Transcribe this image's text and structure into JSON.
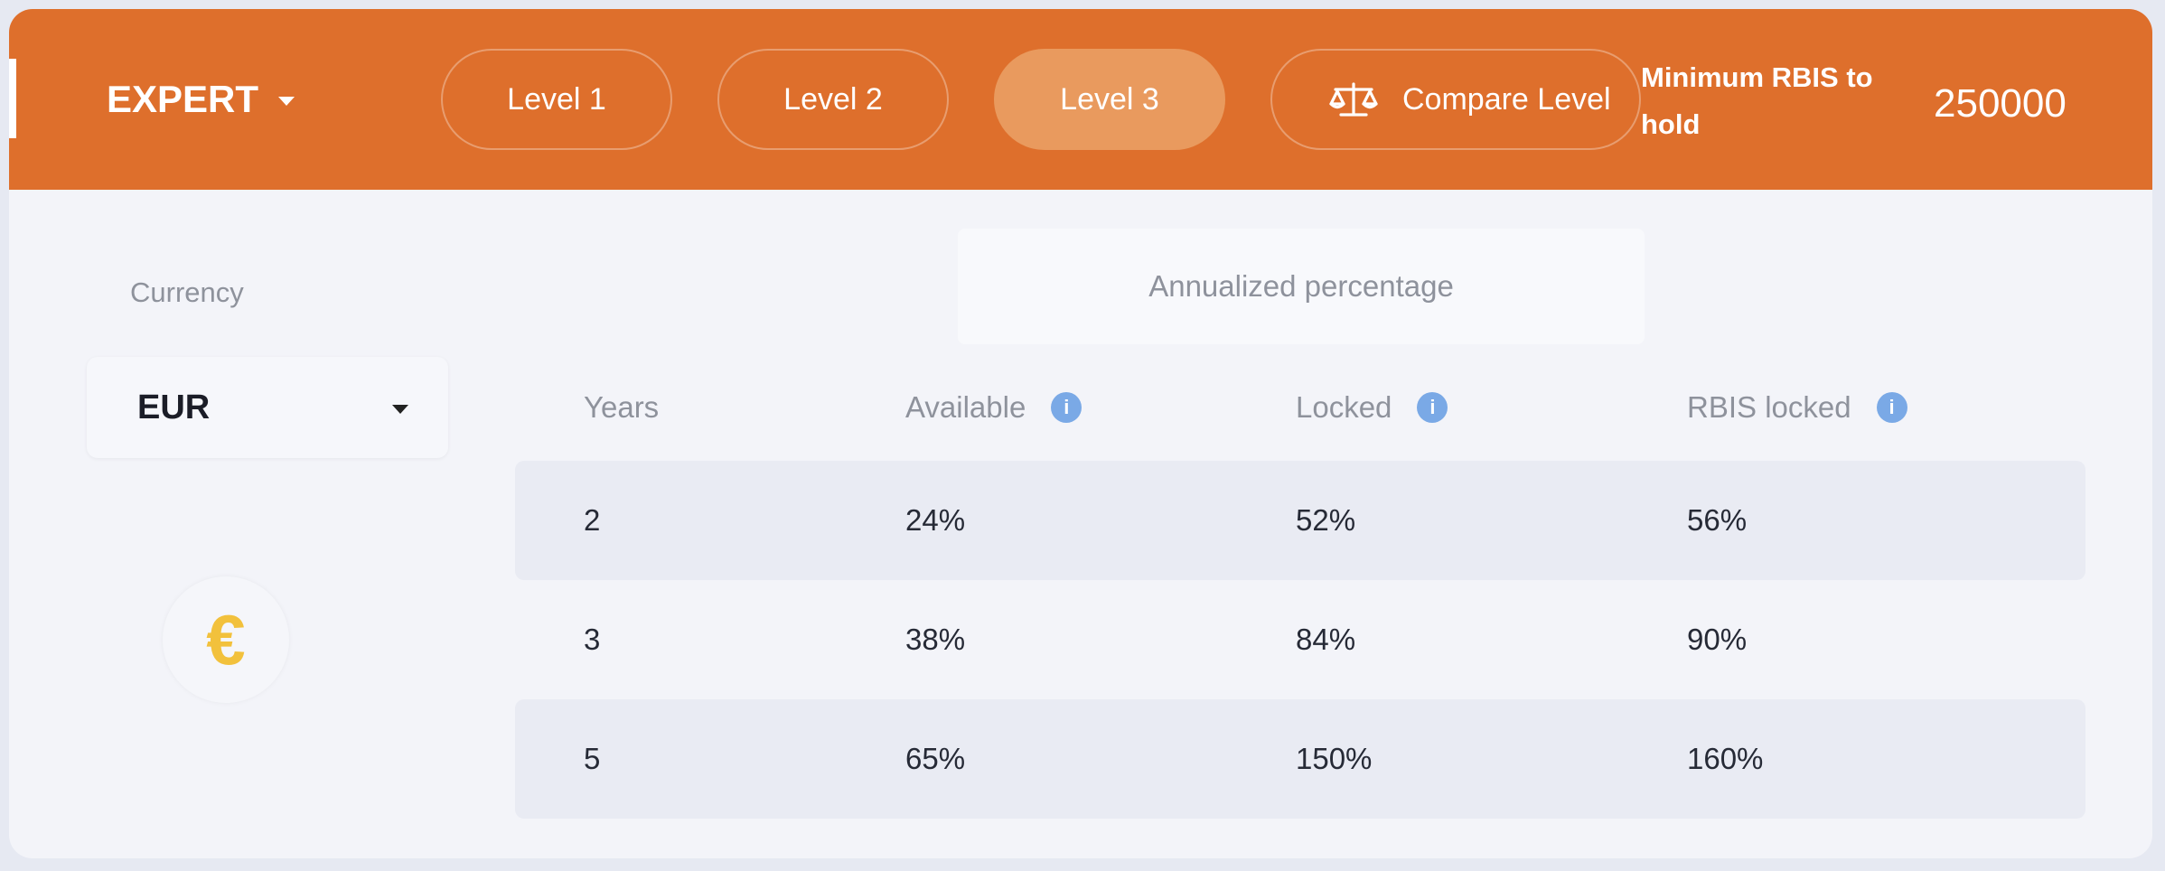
{
  "header": {
    "tier": "EXPERT",
    "levels": [
      {
        "label": "Level 1"
      },
      {
        "label": "Level 2"
      },
      {
        "label": "Level 3"
      }
    ],
    "compare_label": "Compare Level",
    "min_label": "Minimum RBIS to hold",
    "min_value": "250000"
  },
  "currency": {
    "label": "Currency",
    "selected": "EUR",
    "symbol": "€"
  },
  "table": {
    "group_header": "Annualized percentage",
    "columns": [
      "Years",
      "Available",
      "Locked",
      "RBIS locked"
    ],
    "rows": [
      [
        "2",
        "24%",
        "52%",
        "56%"
      ],
      [
        "3",
        "38%",
        "84%",
        "90%"
      ],
      [
        "5",
        "65%",
        "150%",
        "160%"
      ]
    ]
  },
  "colors": {
    "header": "#de6f2c",
    "active_level": "#e99a5e",
    "info": "#7aa9e6",
    "currency_symbol": "#f2c13c"
  }
}
